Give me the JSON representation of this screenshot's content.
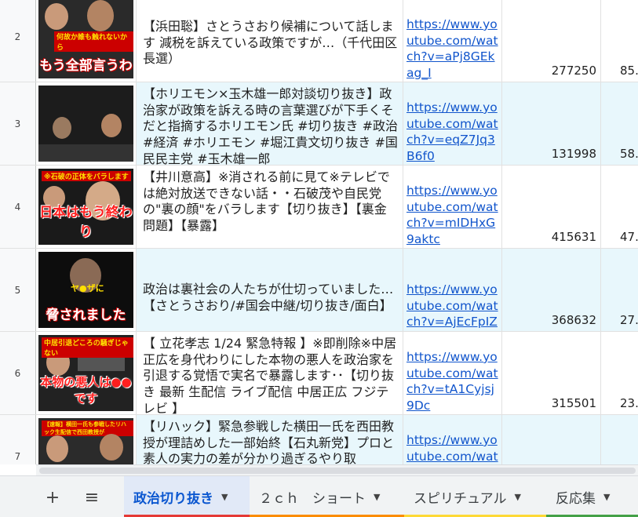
{
  "rows": [
    {
      "num": "2",
      "title": "【浜田聡】さとうさおり候補について話します 減税を訴えている政策ですが…（千代田区長選）",
      "url": "https://www.youtube.com/watch?v=aPj8GEkag_I",
      "views": "277250",
      "rate": "85.",
      "thumb_top": "何故か誰も触れないから",
      "thumb_caption": "もう全部言うわ",
      "thumb_style": "white"
    },
    {
      "num": "3",
      "title": "【ホリエモン×玉木雄一郎対談切り抜き】政治家が政策を訴える時の言葉選びが下手くそだと指摘するホリエモン氏 #切り抜き #政治 #経済 #ホリエモン #堀江貴文切り抜き #国民民主党 #玉木雄一郎",
      "url": "https://www.youtube.com/watch?v=eqZ7Jq3B6f0",
      "views": "131998",
      "rate": "58.",
      "thumb_top": "",
      "thumb_caption": "",
      "thumb_style": "white"
    },
    {
      "num": "4",
      "title": "【井川意高】※消される前に見て※テレビでは絶対放送できない話・・石破茂や自民党の\"裏の顔\"をバラします【切り抜き】【裏金問題】【暴露】",
      "url": "https://www.youtube.com/watch?v=mIDHxG9aktc",
      "views": "415631",
      "rate": "47.",
      "thumb_top": "※石破の正体をバラします",
      "thumb_caption": "日本はもう終わり",
      "thumb_style": "red"
    },
    {
      "num": "5",
      "title": "政治は裏社会の人たちが仕切っていました…【さとうさおり/#国会中継/切り抜き/面白】",
      "url": "https://www.youtube.com/watch?v=AjEcFpIZfJc",
      "views": "368632",
      "rate": "27.",
      "thumb_top": "ヤ●ザに",
      "thumb_caption": "脅されました",
      "thumb_style": "white"
    },
    {
      "num": "6",
      "title": "【 立花孝志 1/24 緊急特報 】※即削除※中居正広を身代わりにした本物の悪人を政治家を引退する覚悟で実名で暴露します･･【切り抜き 最新 生配信 ライブ配信 中居正広 フジテレビ 】",
      "url": "https://www.youtube.com/watch?v=tA1Cyjsj9Dc",
      "views": "315501",
      "rate": "23.",
      "thumb_top": "中居引退どころの騒ぎじゃない",
      "thumb_caption": "本物の悪人は●●です",
      "thumb_style": "white"
    },
    {
      "num": "7",
      "title": "【リハック】緊急参戦した横田一氏を西田教授が理詰めした一部始終【石丸新党】プロと素人の実力の差が分かり過ぎるやり取",
      "url": "https://www.youtube.com/watch",
      "views": "",
      "rate": "",
      "thumb_top": "【速報】横田一氏も参戦したリハック生配信で西田教授が",
      "thumb_caption": "",
      "thumb_style": "white"
    }
  ],
  "tabbar": {
    "add_label": "+",
    "menu_label": "≡",
    "tabs": [
      {
        "label": "政治切り抜き",
        "color": "#e53935",
        "active": true
      },
      {
        "label": "２ｃｈ　ショート",
        "color": "#fb8c00",
        "active": false
      },
      {
        "label": "スピリチュアル",
        "color": "#fdd835",
        "active": false
      },
      {
        "label": "反応集",
        "color": "#43a047",
        "active": false
      }
    ],
    "arrow": "▼"
  }
}
